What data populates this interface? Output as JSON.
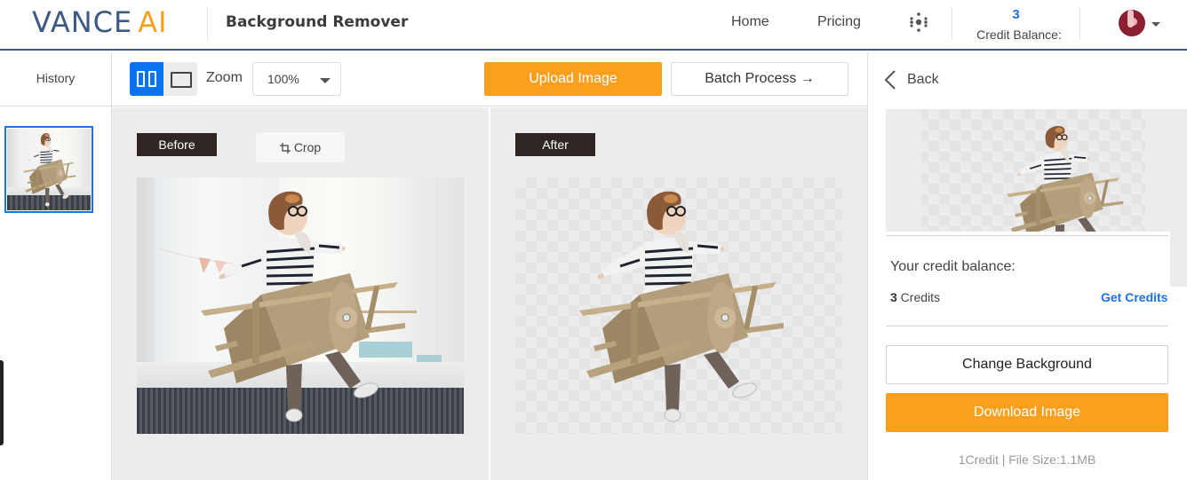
{
  "header": {
    "logo_primary": "VANCE",
    "logo_accent": "AI",
    "app_title": "Background Remover",
    "nav": [
      {
        "label": "Home"
      },
      {
        "label": "Pricing"
      }
    ],
    "apps_icon": "apps-grid-icon",
    "credit_count": "3",
    "credit_label": "Credit Balance:",
    "avatar_icon": "user-avatar",
    "colors": {
      "brand_blue": "#3d5a84",
      "brand_orange": "#f5a023",
      "link_blue": "#1a73e8"
    }
  },
  "history": {
    "title": "History",
    "items": [
      {
        "thumb": "child-cardboard-airplane",
        "selected": true
      }
    ]
  },
  "toolbar": {
    "view_modes": [
      {
        "name": "split-view",
        "icon": "split-view-icon",
        "active": true
      },
      {
        "name": "single-view",
        "icon": "single-view-icon",
        "active": false
      }
    ],
    "zoom_label": "Zoom",
    "zoom_value": "100%",
    "upload_label": "Upload Image",
    "batch_label": "Batch Process →",
    "accent_color": "#fb9f1e"
  },
  "compare": {
    "before_label": "Before",
    "crop_label": "Crop",
    "after_label": "After",
    "before_image": "child-cardboard-airplane-original",
    "after_image": "child-cardboard-airplane-transparent"
  },
  "panel": {
    "back_label": "Back",
    "credit_heading": "Your credit balance:",
    "credit_amount": "3",
    "credit_unit": " Credits",
    "get_credits_label": "Get Credits",
    "change_bg_label": "Change Background",
    "download_label": "Download Image",
    "file_info": "1Credit | File Size:1.1MB"
  }
}
